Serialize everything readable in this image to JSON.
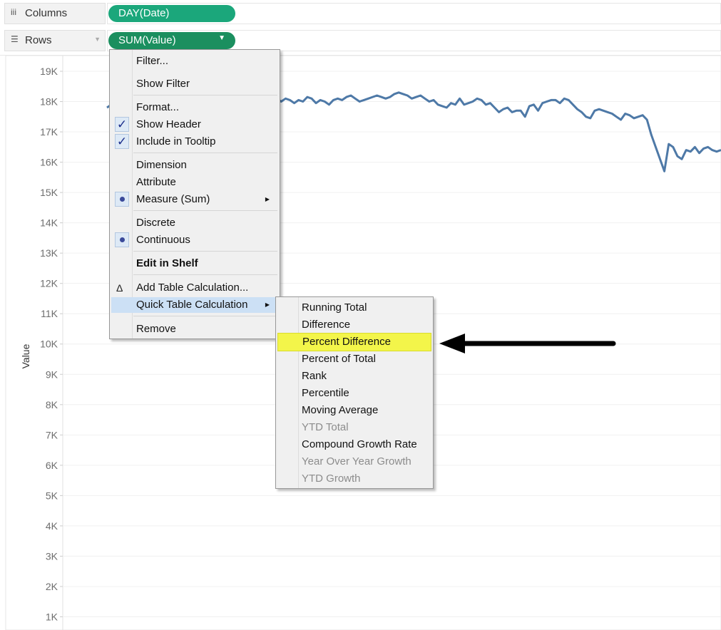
{
  "shelves": {
    "columns": {
      "icon": "iii",
      "label": "Columns",
      "pill": "DAY(Date)",
      "pill_color": "#1ba77b"
    },
    "rows": {
      "icon": "☰",
      "label": "Rows",
      "pill": "SUM(Value)",
      "pill_color": "#1b8f5f",
      "pill_arrow": "▼"
    }
  },
  "context_menu": {
    "items": [
      {
        "label": "Filter...",
        "mark": "",
        "bold": false
      },
      {
        "label": "Show Filter",
        "mark": "",
        "bold": false
      },
      {
        "label": "Format...",
        "mark": "",
        "bold": false
      },
      {
        "label": "Show Header",
        "mark": "check",
        "bold": false
      },
      {
        "label": "Include in Tooltip",
        "mark": "check",
        "bold": false
      },
      {
        "label": "Dimension",
        "mark": "",
        "bold": false
      },
      {
        "label": "Attribute",
        "mark": "",
        "bold": false
      },
      {
        "label": "Measure (Sum)",
        "mark": "radio",
        "submenu": true
      },
      {
        "label": "Discrete",
        "mark": "",
        "bold": false
      },
      {
        "label": "Continuous",
        "mark": "radio",
        "bold": false
      },
      {
        "label": "Edit in Shelf",
        "mark": "",
        "bold": true
      },
      {
        "label": "Add Table Calculation...",
        "mark": "delta",
        "bold": false
      },
      {
        "label": "Quick Table Calculation",
        "mark": "",
        "submenu": true,
        "highlighted": true
      },
      {
        "label": "Remove",
        "mark": "",
        "bold": false
      }
    ],
    "check_glyph": "✓",
    "delta_glyph": "Δ",
    "submenu_glyph": "▶"
  },
  "quick_calc_menu": {
    "items": [
      {
        "label": "Running Total",
        "disabled": false
      },
      {
        "label": "Difference",
        "disabled": false
      },
      {
        "label": "Percent Difference",
        "disabled": false,
        "highlighted": true
      },
      {
        "label": "Percent of Total",
        "disabled": false
      },
      {
        "label": "Rank",
        "disabled": false
      },
      {
        "label": "Percentile",
        "disabled": false
      },
      {
        "label": "Moving Average",
        "disabled": false
      },
      {
        "label": "YTD Total",
        "disabled": true
      },
      {
        "label": "Compound Growth Rate",
        "disabled": false
      },
      {
        "label": "Year Over Year Growth",
        "disabled": true
      },
      {
        "label": "YTD Growth",
        "disabled": true
      }
    ]
  },
  "annotation": {
    "arrow": "left-pointing-arrow",
    "color": "#000000",
    "highlight_color": "#f3f54a"
  },
  "chart_data": {
    "type": "line",
    "title": "",
    "xlabel": "",
    "ylabel": "Value",
    "ylim": [
      0,
      19000
    ],
    "yticks": [
      "1K",
      "2K",
      "3K",
      "4K",
      "5K",
      "6K",
      "7K",
      "8K",
      "9K",
      "10K",
      "11K",
      "12K",
      "13K",
      "14K",
      "15K",
      "16K",
      "17K",
      "18K",
      "19K"
    ],
    "grid": true,
    "line_color": "#4e79a7",
    "series": [
      {
        "values": [
          17800,
          17900,
          17600,
          17750,
          17850,
          17950,
          17800,
          17900,
          18050,
          17700,
          17800,
          17900,
          18000,
          17950,
          17850,
          17900,
          18100,
          18000,
          17800,
          18050,
          18150,
          17950,
          18100,
          18000,
          17850,
          17850,
          18050,
          18100,
          17900,
          17800,
          17950,
          18100,
          18050,
          17900,
          17850,
          17950,
          18050,
          17850,
          17900,
          18100,
          18000,
          18100,
          18050,
          17950,
          18050,
          18000,
          18150,
          18100,
          17950,
          18050,
          18000,
          17900,
          18050,
          18100,
          18050,
          18150,
          18200,
          18100,
          18000,
          18050,
          18100,
          18150,
          18200,
          18150,
          18100,
          18150,
          18250,
          18300,
          18250,
          18200,
          18100,
          18150,
          18200,
          18100,
          18000,
          18050,
          17900,
          17850,
          17800,
          17950,
          17900,
          18100,
          17900,
          17950,
          18000,
          18100,
          18050,
          17900,
          17950,
          17800,
          17650,
          17750,
          17800,
          17650,
          17700,
          17700,
          17500,
          17850,
          17900,
          17700,
          17950,
          18000,
          18050,
          18050,
          17950,
          18100,
          18050,
          17900,
          17750,
          17650,
          17500,
          17450,
          17700,
          17750,
          17700,
          17650,
          17600,
          17500,
          17400,
          17600,
          17550,
          17450,
          17500,
          17550,
          17400,
          16900,
          16500,
          16100,
          15700,
          16600,
          16500,
          16200,
          16100,
          16400,
          16350,
          16500,
          16300,
          16450,
          16500,
          16400,
          16350,
          16400
        ]
      }
    ]
  }
}
